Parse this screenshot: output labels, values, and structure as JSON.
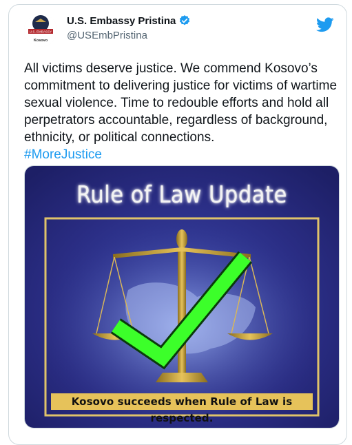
{
  "account": {
    "display_name": "U.S. Embassy Pristina",
    "handle": "@USEmbPristina",
    "avatar_label_top": "U.S. EMBASSY",
    "avatar_label_bottom": "Kosovo"
  },
  "tweet": {
    "body": "All victims deserve justice. We commend Kosovo’s commitment to delivering justice for victims of wartime sexual violence. Time to redouble efforts and hold all perpetrators accountable, regardless of background, ethnicity, or political connections.",
    "hashtag": "#MoreJustice"
  },
  "image": {
    "headline": "Rule of Law Update",
    "caption": "Kosovo succeeds when Rule of Law is respected."
  },
  "colors": {
    "brand_blue": "#1d9bf0",
    "image_bg": "#2a2d84",
    "frame_gold": "#e0c36a",
    "check_green": "#3cff2a"
  },
  "icons": [
    "verified-badge-icon",
    "twitter-bird-icon",
    "scales-of-justice-icon",
    "check-mark-icon"
  ]
}
